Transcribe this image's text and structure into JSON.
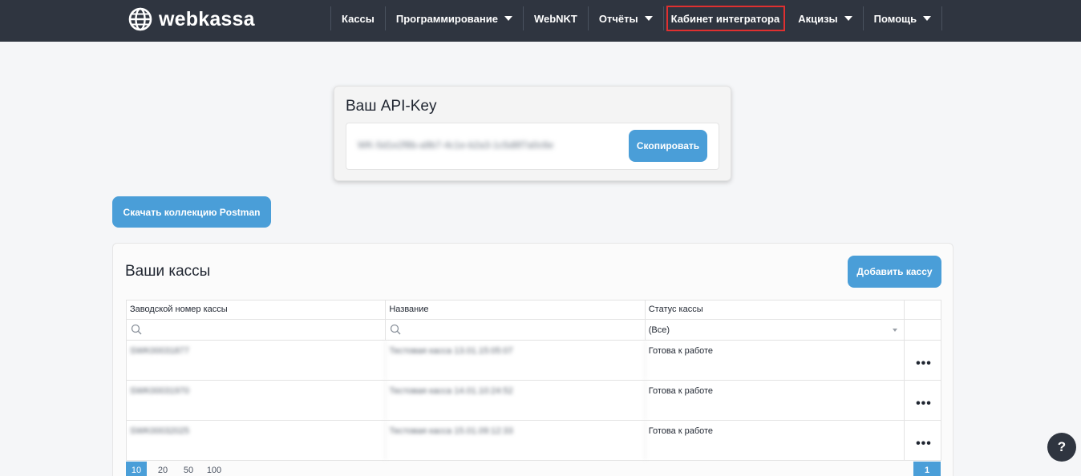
{
  "brand": {
    "name": "webkassa"
  },
  "nav": {
    "items": [
      {
        "label": "Кассы",
        "dropdown": false
      },
      {
        "label": "Программирование",
        "dropdown": true
      },
      {
        "label": "WebNKT",
        "dropdown": false
      },
      {
        "label": "Отчёты",
        "dropdown": true
      },
      {
        "label": "Кабинет интегратора",
        "dropdown": false,
        "active": true
      },
      {
        "label": "Акцизы",
        "dropdown": true
      },
      {
        "label": "Помощь",
        "dropdown": true
      }
    ]
  },
  "api_key": {
    "title": "Ваш API-Key",
    "value": "WK-5d1e2f8b-a9b7-4c1e-b2a3-1c5d8f7a0c6e",
    "copy_label": "Скопировать"
  },
  "postman": {
    "label": "Скачать коллекцию Postman"
  },
  "kassy": {
    "title": "Ваши кассы",
    "add_label": "Добавить кассу",
    "columns": [
      "Заводской номер кассы",
      "Название",
      "Статус кассы"
    ],
    "status_filter": "(Все)",
    "rows": [
      {
        "serial": "SWK00031877",
        "name": "Тестовая касса 13.01.15:05:07",
        "status": "Готова к работе"
      },
      {
        "serial": "SWK00031970",
        "name": "Тестовая касса 14.01.10:24:52",
        "status": "Готова к работе"
      },
      {
        "serial": "SWK00032025",
        "name": "Тестовая касса 15.01.09:12:33",
        "status": "Готова к работе"
      }
    ],
    "row_menu": "•••",
    "page_sizes": [
      "10",
      "20",
      "50",
      "100"
    ],
    "current_page": "1"
  },
  "help": {
    "label": "?"
  },
  "colors": {
    "navbar": "#2f3540",
    "accent": "#4a9ed8",
    "active_outline": "#e03030",
    "background": "#f5f6f8"
  },
  "icons": {
    "logo": "globe-icon",
    "search": "search-icon",
    "dropdown": "caret-down-icon",
    "row_menu": "more-dots-icon",
    "help": "question-icon"
  }
}
